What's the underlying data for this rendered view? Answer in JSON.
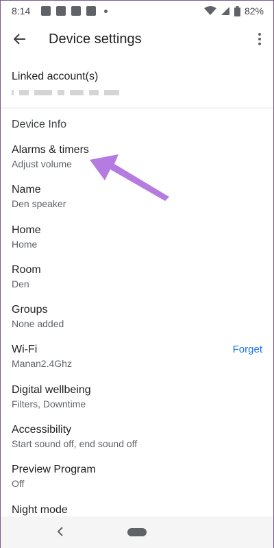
{
  "status_bar": {
    "time": "8:14",
    "battery": "82%"
  },
  "app_bar": {
    "title": "Device settings"
  },
  "linked_account": {
    "title": "Linked account(s)"
  },
  "section": {
    "title": "Device Info"
  },
  "items": [
    {
      "label": "Alarms & timers",
      "sub": "Adjust volume",
      "action": ""
    },
    {
      "label": "Name",
      "sub": "Den speaker",
      "action": ""
    },
    {
      "label": "Home",
      "sub": "Home",
      "action": ""
    },
    {
      "label": "Room",
      "sub": "Den",
      "action": ""
    },
    {
      "label": "Groups",
      "sub": "None added",
      "action": ""
    },
    {
      "label": "Wi-Fi",
      "sub": "Manan2.4Ghz",
      "action": "Forget"
    },
    {
      "label": "Digital wellbeing",
      "sub": "Filters, Downtime",
      "action": ""
    },
    {
      "label": "Accessibility",
      "sub": "Start sound off, end sound off",
      "action": ""
    },
    {
      "label": "Preview Program",
      "sub": "Off",
      "action": ""
    },
    {
      "label": "Night mode",
      "sub": "",
      "action": ""
    }
  ],
  "colors": {
    "accent": "#1a73e8",
    "annotation": "#b57be0"
  },
  "icons": [
    "back-arrow-icon",
    "more-vert-icon",
    "wifi-icon",
    "battery-icon",
    "nav-back-icon",
    "nav-home-icon"
  ]
}
